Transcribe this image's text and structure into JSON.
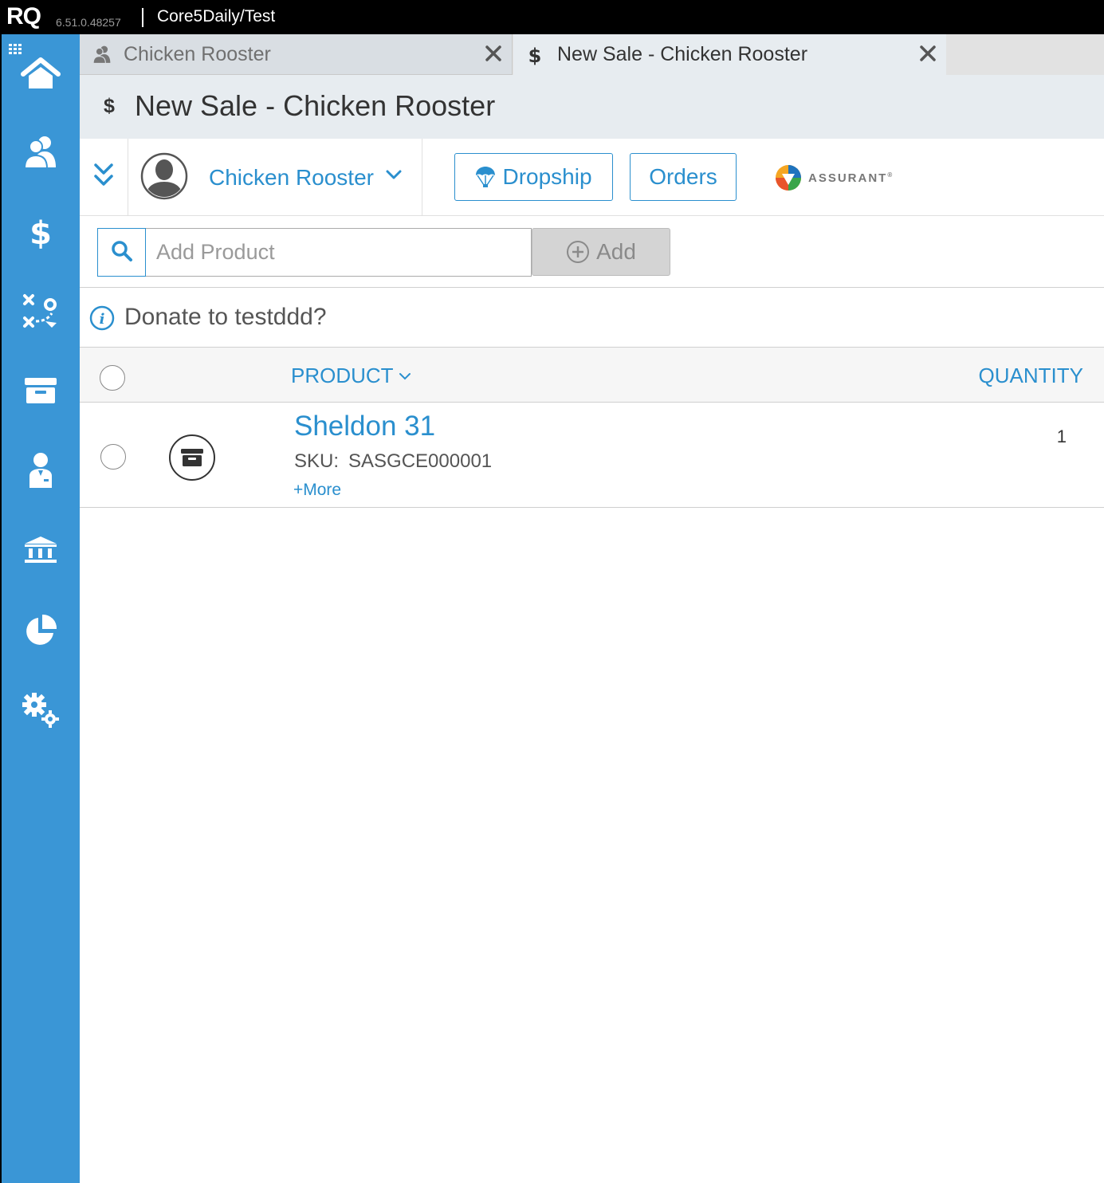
{
  "app": {
    "logo": "RQ",
    "version": "6.51.0.48257",
    "database": "Core5Daily/Test"
  },
  "sidebar": {
    "items": [
      {
        "icon": "home-icon"
      },
      {
        "icon": "customers-icon"
      },
      {
        "icon": "sales-icon"
      },
      {
        "icon": "strategy-icon"
      },
      {
        "icon": "inventory-icon"
      },
      {
        "icon": "employee-icon"
      },
      {
        "icon": "banking-icon"
      },
      {
        "icon": "reports-icon"
      },
      {
        "icon": "settings-icon"
      }
    ],
    "color": "#3a96d6"
  },
  "tabs": [
    {
      "label": "Chicken Rooster",
      "icon": "customers-icon",
      "active": false
    },
    {
      "label": "New Sale - Chicken Rooster",
      "icon": "dollar-icon",
      "active": true
    }
  ],
  "header": {
    "icon_glyph": "$",
    "title": "New Sale - Chicken Rooster"
  },
  "toolbar": {
    "customer_name": "Chicken Rooster",
    "dropship_label": "Dropship",
    "orders_label": "Orders",
    "assurant_label": "ASSURANT",
    "assurant_mark": "®"
  },
  "search": {
    "placeholder": "Add Product",
    "value": "",
    "add_label": "Add"
  },
  "donate": {
    "text": "Donate to testddd?"
  },
  "table": {
    "columns": {
      "product": "PRODUCT",
      "quantity": "QUANTITY"
    },
    "rows": [
      {
        "name": "Sheldon 31",
        "sku_label": "SKU:",
        "sku": "SASGCE000001",
        "more": "+More",
        "quantity": "1"
      }
    ]
  },
  "colors": {
    "accent": "#2a8fce",
    "sidebar": "#3a96d6",
    "header_bg": "#e7ecf0"
  }
}
